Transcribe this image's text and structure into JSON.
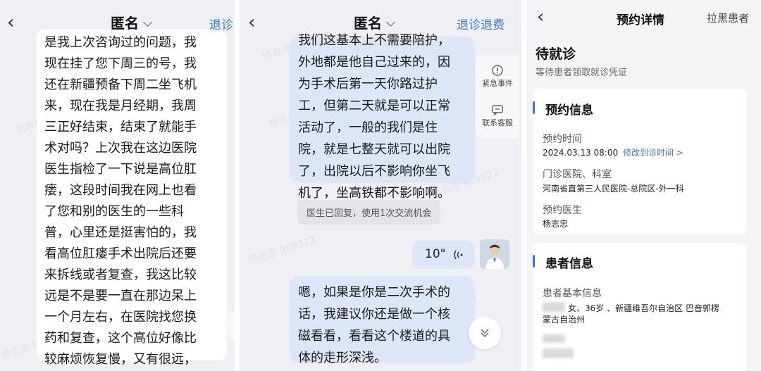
{
  "panel1": {
    "header": {
      "title": "匿名",
      "action": "退诊"
    },
    "message_lines": [
      "是我上次咨询过的问题，我",
      "现在挂了您下周三的号，我",
      "还在新疆预备下周二坐飞机",
      "来，现在我是月经期，我周",
      "三正好结束，结束了就能手",
      "术对吗？上次我在这边医院",
      "医生指检了一下说是高位肛",
      "瘘，这段时间我在网上也看",
      "了您和别的医生的一些科",
      "普，心里还是挺害怕的，我",
      "看高位肛瘘手术出院后还要",
      "来拆线或者复查，我这比较",
      "远是不是要一直在那边呆上",
      "一个月左右，在医院找您换",
      "药和复查，这个高位好像比",
      "较麻烦恢复慢，又有很远，"
    ],
    "watermark": "杨志忠 969322"
  },
  "panel2": {
    "header": {
      "title": "匿名",
      "action": "退诊退费"
    },
    "doctor_message_lines": [
      "我们这基本上不需要陪护，",
      "外地都是他自己过来的，因",
      "为手术后第一天你路过护",
      "工，但第二天就是可以正常",
      "活动了，一般的我们是住",
      "院，就是七整天就可以出院",
      "了，出院以后不影响你坐飞",
      "机了，坐高铁都不影响啊。"
    ],
    "side_buttons": [
      {
        "label": "紧急事件",
        "icon": "alert-circle-icon"
      },
      {
        "label": "联系客服",
        "icon": "customer-service-icon"
      }
    ],
    "system_notice": "医生已回复，使用1次交流机会",
    "voice_message": {
      "duration": "10\""
    },
    "reply_lines": [
      "嗯，如果是你是二次手术的",
      "话，我建议你还是做一个核",
      "磁看看，看看这个楼道的具",
      "体的走形深浅。"
    ],
    "watermark": "杨志忠 969322"
  },
  "panel3": {
    "header": {
      "title": "预约详情",
      "action": "拉黑患者"
    },
    "status": {
      "title": "待就诊",
      "subtitle": "等待患者领取就诊凭证"
    },
    "appointment": {
      "section_title": "预约信息",
      "time_label": "预约时间",
      "time_value": "2024.03.13 08:00",
      "change_link": "修改到诊时间 >",
      "hospital_label": "门诊医院、科室",
      "hospital_value": "河南省直第三人民医院-总院区-外一科",
      "doctor_label": "预约医生",
      "doctor_value": "杨志忠"
    },
    "patient": {
      "section_title": "患者信息",
      "basic_label": "患者基本信息",
      "basic_line1": "女、36岁 、新疆维吾尔自治区 巴音郭楞",
      "basic_line2": "蒙古自治州"
    }
  },
  "colors": {
    "accent": "#3d76d8",
    "doctor_bubble": "#dde6f7",
    "background": "#eef0f3"
  }
}
